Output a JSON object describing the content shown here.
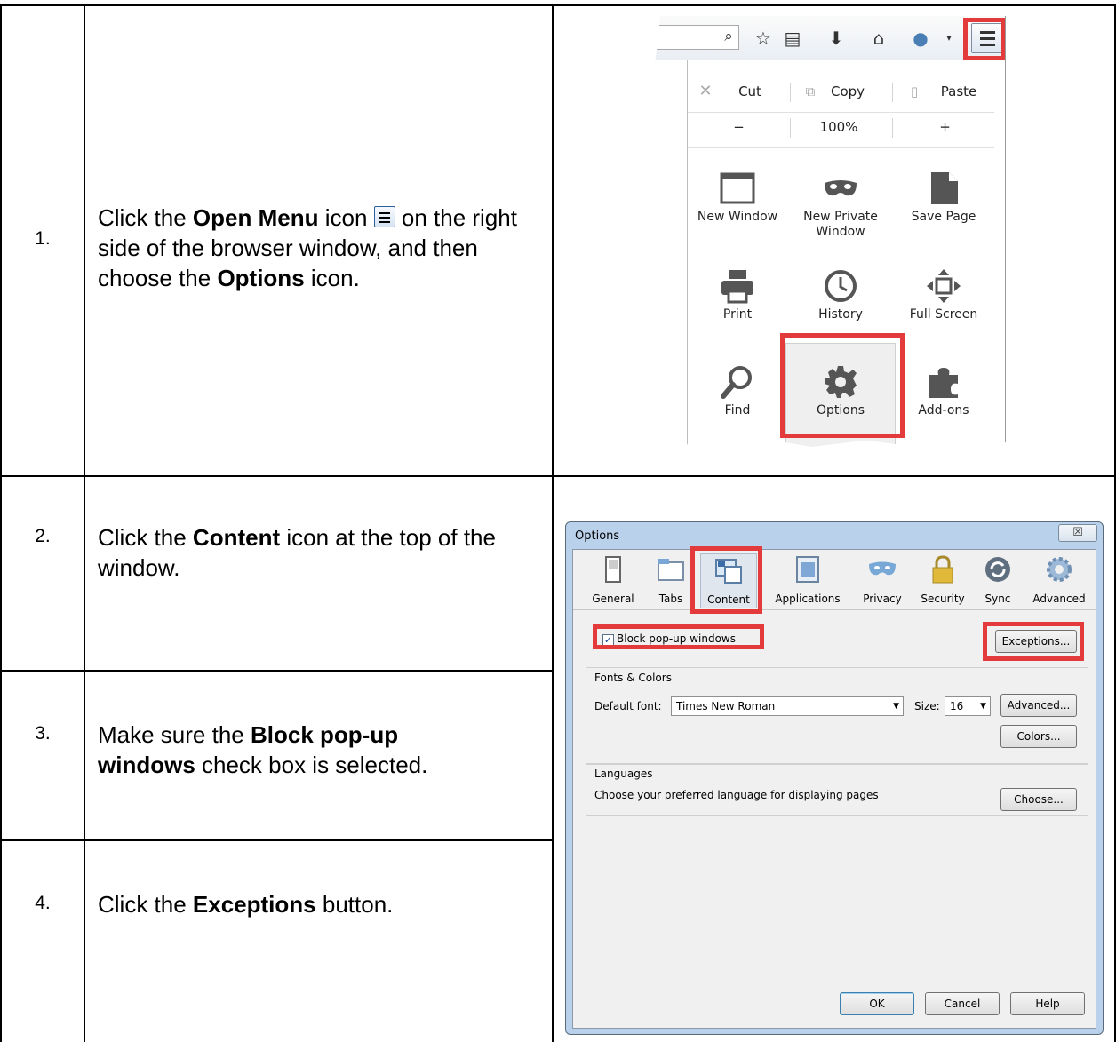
{
  "steps": [
    {
      "number": "1.",
      "parts": [
        "Click the ",
        "Open Menu",
        " icon ",
        " on the right side of the browser window, and then choose the ",
        "Options",
        " icon."
      ]
    },
    {
      "number": "2.",
      "parts": [
        "Click the ",
        "Content",
        " icon at the top of the window."
      ]
    },
    {
      "number": "3.",
      "parts": [
        "Make sure the ",
        "Block pop-up windows",
        " check box is selected."
      ]
    },
    {
      "number": "4.",
      "parts": [
        "Click the ",
        "Exceptions",
        " button."
      ]
    }
  ],
  "firefox_menu": {
    "edit_row": {
      "cut": "Cut",
      "copy": "Copy",
      "paste": "Paste"
    },
    "zoom_row": {
      "minus": "−",
      "level": "100%",
      "plus": "+"
    },
    "items": [
      {
        "label": "New Window",
        "icon": "window-icon"
      },
      {
        "label": "New Private\nWindow",
        "icon": "mask-icon"
      },
      {
        "label": "Save Page",
        "icon": "page-icon"
      },
      {
        "label": "Print",
        "icon": "printer-icon"
      },
      {
        "label": "History",
        "icon": "clock-icon"
      },
      {
        "label": "Full Screen",
        "icon": "fullscreen-icon"
      },
      {
        "label": "Find",
        "icon": "magnifier-icon"
      },
      {
        "label": "Options",
        "icon": "gear-icon"
      },
      {
        "label": "Add-ons",
        "icon": "puzzle-icon"
      }
    ],
    "highlight_color": "#e33b3b"
  },
  "options_dialog": {
    "title": "Options",
    "close": "☒",
    "panes": [
      "General",
      "Tabs",
      "Content",
      "Applications",
      "Privacy",
      "Security",
      "Sync",
      "Advanced"
    ],
    "selected_pane": "Content",
    "block_popups": {
      "label": "Block pop-up windows",
      "checked": true
    },
    "exceptions_button": "Exceptions...",
    "fonts_group": "Fonts & Colors",
    "default_font_label": "Default font:",
    "default_font_value": "Times New Roman",
    "size_label": "Size:",
    "size_value": "16",
    "advanced_button": "Advanced...",
    "colors_button": "Colors...",
    "languages_group": "Languages",
    "languages_text": "Choose your preferred language for displaying pages",
    "choose_button": "Choose...",
    "ok_button": "OK",
    "cancel_button": "Cancel",
    "help_button": "Help"
  }
}
